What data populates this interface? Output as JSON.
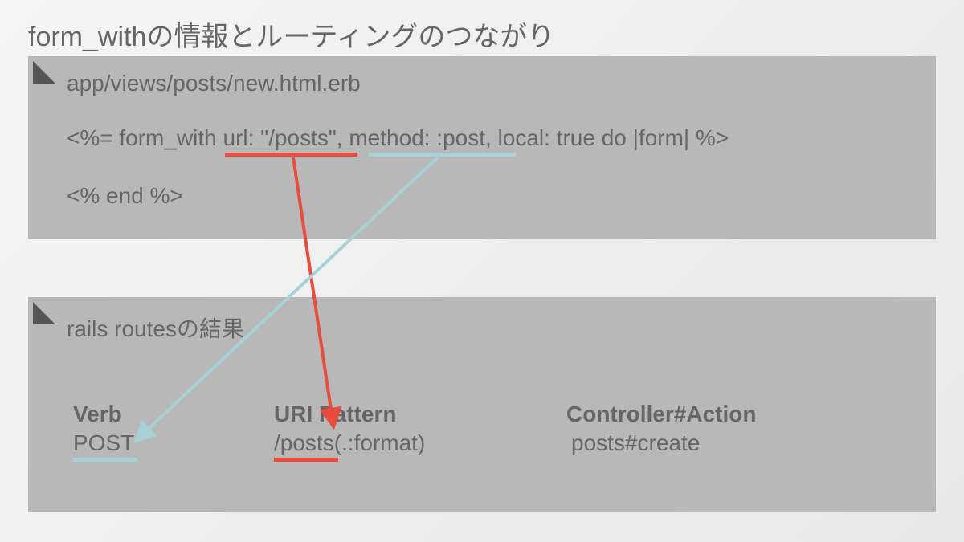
{
  "title": "form_withの情報とルーティングのつながり",
  "panels": {
    "top": {
      "label": "app/views/posts/new.html.erb",
      "code_line_1": "<%= form_with url: \"/posts\", method: :post, local: true do |form| %>",
      "code_line_2": "<% end %>"
    },
    "bottom": {
      "label": "rails routesの結果",
      "headers": {
        "verb": "Verb",
        "uri": "URI Pattern",
        "action": "Controller#Action"
      },
      "row": {
        "verb": "POST",
        "uri": "/posts(.:format)",
        "action": "posts#create"
      }
    }
  },
  "colors": {
    "red": "#e74c3c",
    "teal": "#a7d1d6",
    "panel": "#b8b8b8",
    "text": "#666666"
  },
  "arrows": [
    {
      "from": "url: \"/posts\"",
      "to": "URI Pattern /posts",
      "color": "red"
    },
    {
      "from": "method: :post",
      "to": "Verb POST",
      "color": "teal"
    }
  ]
}
